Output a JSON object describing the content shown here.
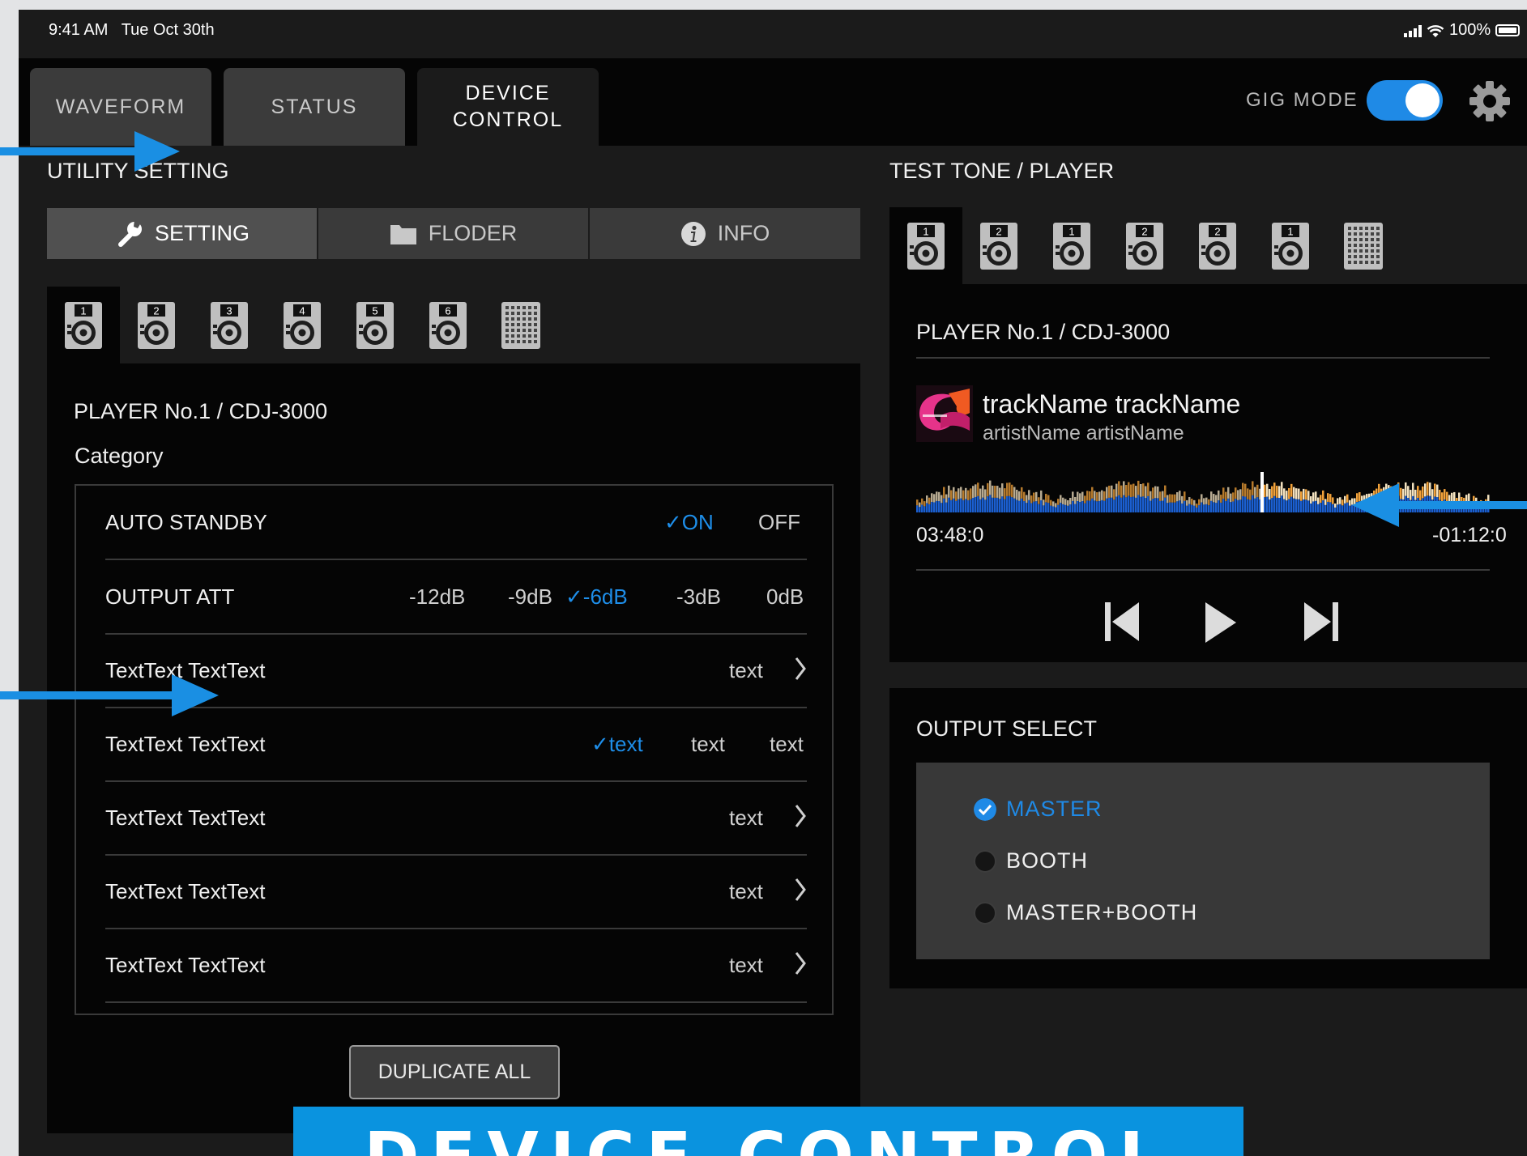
{
  "status_bar": {
    "time": "9:41 AM",
    "date": "Tue Oct 30th",
    "battery": "100%"
  },
  "tabs": [
    {
      "label": "WAVEFORM",
      "active": false
    },
    {
      "label": "STATUS",
      "active": false
    },
    {
      "label": "DEVICE\nCONTROL",
      "active": true
    }
  ],
  "gig_mode": {
    "label": "GIG MODE",
    "on": true
  },
  "utility": {
    "title": "UTILITY SETTING",
    "segments": [
      {
        "label": "SETTING",
        "icon": "wrench-icon",
        "active": true
      },
      {
        "label": "FLODER",
        "icon": "folder-icon",
        "active": false
      },
      {
        "label": "INFO",
        "icon": "info-icon",
        "active": false
      }
    ],
    "devices": [
      "1",
      "2",
      "3",
      "4",
      "5",
      "6"
    ],
    "player_title": "PLAYER No.1 / CDJ-3000",
    "category": "Category",
    "rows": [
      {
        "label": "AUTO STANDBY",
        "options": [
          "ON",
          "OFF"
        ],
        "selected": "ON"
      },
      {
        "label": "OUTPUT ATT",
        "options": [
          "-12dB",
          "-9dB",
          "-6dB",
          "-3dB",
          "0dB"
        ],
        "selected": "-6dB"
      },
      {
        "label": "TextText TextText",
        "value": "text"
      },
      {
        "label": "TextText TextText",
        "options": [
          "text",
          "text",
          "text"
        ],
        "selected_index": 0
      },
      {
        "label": "TextText TextText",
        "value": "text"
      },
      {
        "label": "TextText TextText",
        "value": "text"
      },
      {
        "label": "TextText TextText",
        "value": "text"
      }
    ],
    "duplicate_label": "DUPLICATE ALL"
  },
  "test_tone": {
    "title": "TEST TONE / PLAYER",
    "devices": [
      "1",
      "2",
      "1",
      "2",
      "2",
      "1"
    ],
    "player_title": "PLAYER No.1 / CDJ-3000",
    "track_name": "trackName trackName",
    "artist_name": "artistName artistName",
    "elapsed": "03:48:0",
    "remaining": "-01:12:0",
    "playhead_fraction": 0.6
  },
  "output_select": {
    "title": "OUTPUT SELECT",
    "options": [
      "MASTER",
      "BOOTH",
      "MASTER+BOOTH"
    ],
    "selected": "MASTER"
  },
  "banner": "DEVICE CONTROL",
  "colors": {
    "accent": "#1f8ae6",
    "banner": "#0a93df",
    "background": "#1b1b1b"
  }
}
